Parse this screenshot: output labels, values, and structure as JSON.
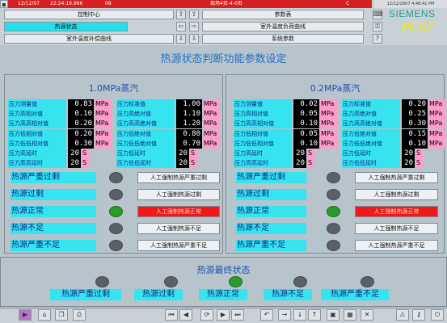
{
  "header": {
    "date": "12/12/07",
    "time": "22:24:19.996",
    "code": "08",
    "alarm_text": "现场4页-4-0页",
    "alarm_status": "C",
    "corner_text": "12/12/2007 4:48:41 PM",
    "brand": "SIEMENS",
    "product": "PCS7",
    "nav_buttons": [
      "控制中心",
      "参数表",
      "热源状态",
      "室外温度负荷曲线",
      "室外温度补偿曲线",
      "系统参数"
    ]
  },
  "title": "热源状态判断功能参数设定",
  "panels": [
    {
      "title": "1.0MPa蒸汽",
      "params_left": [
        {
          "label": "压力测量值",
          "value": "0.83",
          "unit": "MPa"
        },
        {
          "label": "压力高相对值",
          "value": "0.10",
          "unit": "MPa"
        },
        {
          "label": "压力高高相对值",
          "value": "0.20",
          "unit": "MPa"
        },
        {
          "label": "压力低相对值",
          "value": "0.20",
          "unit": "MPa"
        },
        {
          "label": "压力低低相对值",
          "value": "0.30",
          "unit": "MPa"
        },
        {
          "label": "压力高延时",
          "value": "20",
          "unit": "S"
        },
        {
          "label": "压力高高延时",
          "value": "20",
          "unit": "S"
        }
      ],
      "params_right": [
        {
          "label": "压力标准值",
          "value": "1.00",
          "unit": "MPa"
        },
        {
          "label": "压力高绝对值",
          "value": "1.10",
          "unit": "MPa"
        },
        {
          "label": "压力高高绝对值",
          "value": "1.20",
          "unit": "MPa"
        },
        {
          "label": "压力低绝对值",
          "value": "0.80",
          "unit": "MPa"
        },
        {
          "label": "压力低低绝对值",
          "value": "0.70",
          "unit": "MPa"
        },
        {
          "label": "压力低延时",
          "value": "20",
          "unit": "S"
        },
        {
          "label": "压力低低延时",
          "value": "20",
          "unit": "S"
        }
      ],
      "statuses": [
        {
          "label": "热源严重过剩",
          "button": "人工强制热源严重过剩",
          "lamp_on": false,
          "button_active": false
        },
        {
          "label": "热源过剩",
          "button": "人工强制热源过剩",
          "lamp_on": false,
          "button_active": false
        },
        {
          "label": "热源正常",
          "button": "人工强制热源正常",
          "lamp_on": true,
          "button_active": true
        },
        {
          "label": "热源不足",
          "button": "人工强制热源不足",
          "lamp_on": false,
          "button_active": false
        },
        {
          "label": "热源严重不足",
          "button": "人工强制热源严重不足",
          "lamp_on": false,
          "button_active": false
        }
      ]
    },
    {
      "title": "0.2MPa蒸汽",
      "params_left": [
        {
          "label": "压力测量值",
          "value": "0.02",
          "unit": "MPa"
        },
        {
          "label": "压力高相对值",
          "value": "0.05",
          "unit": "MPa"
        },
        {
          "label": "压力高高相对值",
          "value": "0.10",
          "unit": "MPa"
        },
        {
          "label": "压力低相对值",
          "value": "0.05",
          "unit": "MPa"
        },
        {
          "label": "压力低低相对值",
          "value": "0.10",
          "unit": "MPa"
        },
        {
          "label": "压力高延时",
          "value": "20",
          "unit": "S"
        },
        {
          "label": "压力高高延时",
          "value": "20",
          "unit": "S"
        }
      ],
      "params_right": [
        {
          "label": "压力标准值",
          "value": "0.20",
          "unit": "MPa"
        },
        {
          "label": "压力高绝对值",
          "value": "0.25",
          "unit": "MPa"
        },
        {
          "label": "压力高高绝对值",
          "value": "0.30",
          "unit": "MPa"
        },
        {
          "label": "压力低绝对值",
          "value": "0.15",
          "unit": "MPa"
        },
        {
          "label": "压力低低绝对值",
          "value": "0.10",
          "unit": "MPa"
        },
        {
          "label": "压力低延时",
          "value": "20",
          "unit": "S"
        },
        {
          "label": "压力低低延时",
          "value": "20",
          "unit": "S"
        }
      ],
      "statuses": [
        {
          "label": "热源严重过剩",
          "button": "人工强制热源严重过剩",
          "lamp_on": false,
          "button_active": false
        },
        {
          "label": "热源过剩",
          "button": "人工强制热源过剩",
          "lamp_on": false,
          "button_active": false
        },
        {
          "label": "热源正常",
          "button": "人工强制热源正常",
          "lamp_on": true,
          "button_active": true
        },
        {
          "label": "热源不足",
          "button": "人工强制热源不足",
          "lamp_on": false,
          "button_active": false
        },
        {
          "label": "热源严重不足",
          "button": "人工强制热源严重不足",
          "lamp_on": false,
          "button_active": false
        }
      ]
    }
  ],
  "final_state": {
    "title": "热源最终状态",
    "items": [
      {
        "label": "热源严重过剩",
        "lamp_on": false
      },
      {
        "label": "热源过剩",
        "lamp_on": false
      },
      {
        "label": "热源正常",
        "lamp_on": true
      },
      {
        "label": "热源不足",
        "lamp_on": false
      },
      {
        "label": "热源严重不足",
        "lamp_on": false
      }
    ]
  },
  "colors": {
    "accent_cyan": "#36e4f0",
    "lamp_on": "#2a9a28",
    "lamp_off": "#5a6066",
    "active_red": "#f01818",
    "unit_pink": "#ff9ccc",
    "alarm_red": "#d42020"
  },
  "bottom_toolbar_icons": [
    "play-icon",
    "back-icon",
    "copy-icon",
    "print-icon",
    "first-page-icon",
    "prev-page-icon",
    "refresh-icon",
    "next-page-icon",
    "last-page-icon",
    "undo-icon",
    "forward-icon",
    "down-icon",
    "up-icon",
    "window-icon",
    "grid-icon",
    "cancel-icon",
    "alarm-icon",
    "key-icon",
    "exit-icon"
  ]
}
